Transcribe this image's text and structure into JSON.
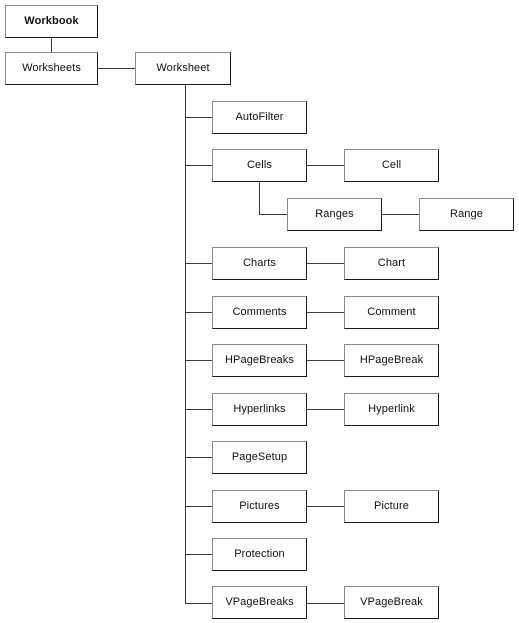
{
  "diagram": {
    "type": "object-model-hierarchy",
    "root": {
      "label": "Workbook",
      "bold": true
    },
    "collection": {
      "label": "Worksheets"
    },
    "parent": {
      "label": "Worksheet"
    },
    "children": [
      {
        "collection": "AutoFilter",
        "item": ""
      },
      {
        "collection": "Cells",
        "item": "Cell"
      },
      {
        "collection": "Ranges",
        "item": "Range"
      },
      {
        "collection": "Charts",
        "item": "Chart"
      },
      {
        "collection": "Comments",
        "item": "Comment"
      },
      {
        "collection": "HPageBreaks",
        "item": "HPageBreak"
      },
      {
        "collection": "Hyperlinks",
        "item": "Hyperlink"
      },
      {
        "collection": "PageSetup",
        "item": ""
      },
      {
        "collection": "Pictures",
        "item": "Picture"
      },
      {
        "collection": "Protection",
        "item": ""
      },
      {
        "collection": "VPageBreaks",
        "item": "VPageBreak"
      }
    ],
    "colors": {
      "box_border_dark": "#1a1a1a",
      "box_border_light": "#8a8a8a",
      "connector": "#3b3b3b",
      "text": "#111111",
      "background": "#ffffff"
    }
  }
}
